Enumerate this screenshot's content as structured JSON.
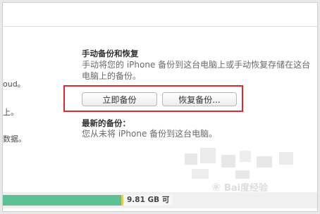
{
  "left_panel": {
    "fragment_1": "oud。",
    "fragment_2": "上。",
    "fragment_3": "数据。"
  },
  "manual_backup": {
    "title": "手动备份和恢复",
    "description": "手动将您的 iPhone 备份到这台电脑上或手动恢复存储在这台电脑上的备份。",
    "backup_now_label": "立即备份",
    "restore_backup_label": "恢复备份..."
  },
  "latest_backup": {
    "title": "最新的备份：",
    "status": "您从未将 iPhone 备份到这台电脑。"
  },
  "storage": {
    "free_label": "9.81 GB 可"
  },
  "watermark": {
    "text": "Bai度经验"
  },
  "colors": {
    "highlight": "#e3262c",
    "storage_used": "#5cc194",
    "storage_other": "#e6cd4a"
  }
}
